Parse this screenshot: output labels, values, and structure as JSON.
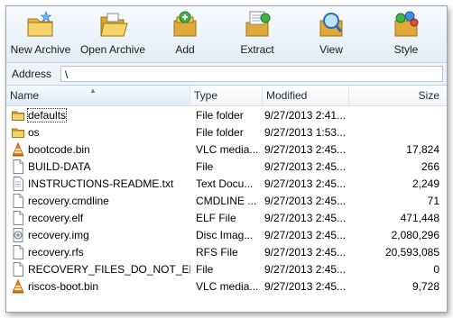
{
  "toolbar": {
    "buttons": [
      {
        "label": "New Archive",
        "icon": "new-archive-icon"
      },
      {
        "label": "Open Archive",
        "icon": "open-archive-icon"
      },
      {
        "label": "Add",
        "icon": "add-icon"
      },
      {
        "label": "Extract",
        "icon": "extract-icon"
      },
      {
        "label": "View",
        "icon": "view-icon"
      },
      {
        "label": "Style",
        "icon": "style-icon"
      }
    ]
  },
  "address": {
    "label": "Address",
    "value": "\\"
  },
  "columns": {
    "name": "Name",
    "type": "Type",
    "modified": "Modified",
    "size": "Size"
  },
  "files": [
    {
      "name": "defaults",
      "type": "File folder",
      "modified": "9/27/2013 2:41...",
      "size": "",
      "icon": "folder-icon"
    },
    {
      "name": "os",
      "type": "File folder",
      "modified": "9/27/2013 1:53...",
      "size": "",
      "icon": "folder-icon"
    },
    {
      "name": "bootcode.bin",
      "type": "VLC media...",
      "modified": "9/27/2013 2:45...",
      "size": "17,824",
      "icon": "vlc-icon"
    },
    {
      "name": "BUILD-DATA",
      "type": "File",
      "modified": "9/27/2013 2:45...",
      "size": "266",
      "icon": "file-icon"
    },
    {
      "name": "INSTRUCTIONS-README.txt",
      "type": "Text Docu...",
      "modified": "9/27/2013 2:45...",
      "size": "2,249",
      "icon": "text-file-icon"
    },
    {
      "name": "recovery.cmdline",
      "type": "CMDLINE ...",
      "modified": "9/27/2013 2:45...",
      "size": "71",
      "icon": "file-icon"
    },
    {
      "name": "recovery.elf",
      "type": "ELF File",
      "modified": "9/27/2013 2:45...",
      "size": "471,448",
      "icon": "file-icon"
    },
    {
      "name": "recovery.img",
      "type": "Disc Imag...",
      "modified": "9/27/2013 2:45...",
      "size": "2,080,296",
      "icon": "disc-image-icon"
    },
    {
      "name": "recovery.rfs",
      "type": "RFS File",
      "modified": "9/27/2013 2:45...",
      "size": "20,593,085",
      "icon": "file-icon"
    },
    {
      "name": "RECOVERY_FILES_DO_NOT_EDIT",
      "type": "File",
      "modified": "9/27/2013 2:45...",
      "size": "0",
      "icon": "file-icon"
    },
    {
      "name": "riscos-boot.bin",
      "type": "VLC media...",
      "modified": "9/27/2013 2:45...",
      "size": "9,728",
      "icon": "vlc-icon"
    }
  ]
}
